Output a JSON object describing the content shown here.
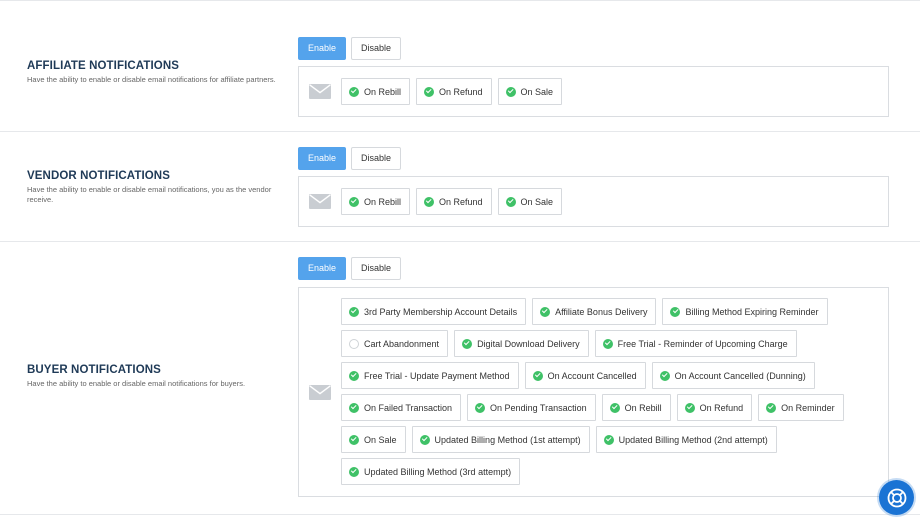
{
  "affiliate": {
    "title": "AFFILIATE NOTIFICATIONS",
    "description": "Have the ability to enable or disable email notifications for affiliate partners.",
    "enable_label": "Enable",
    "disable_label": "Disable",
    "enabled": true,
    "options": [
      {
        "label": "On Rebill",
        "checked": true
      },
      {
        "label": "On Refund",
        "checked": true
      },
      {
        "label": "On Sale",
        "checked": true
      }
    ]
  },
  "vendor": {
    "title": "VENDOR NOTIFICATIONS",
    "description": "Have the ability to enable or disable email notifications, you as the vendor receive.",
    "enable_label": "Enable",
    "disable_label": "Disable",
    "enabled": true,
    "options": [
      {
        "label": "On Rebill",
        "checked": true
      },
      {
        "label": "On Refund",
        "checked": true
      },
      {
        "label": "On Sale",
        "checked": true
      }
    ]
  },
  "buyer": {
    "title": "BUYER NOTIFICATIONS",
    "description": "Have the ability to enable or disable email notifications for buyers.",
    "enable_label": "Enable",
    "disable_label": "Disable",
    "enabled": true,
    "options": [
      {
        "label": "3rd Party Membership Account Details",
        "checked": true
      },
      {
        "label": "Affiliate Bonus Delivery",
        "checked": true
      },
      {
        "label": "Billing Method Expiring Reminder",
        "checked": true
      },
      {
        "label": "Cart Abandonment",
        "checked": false
      },
      {
        "label": "Digital Download Delivery",
        "checked": true
      },
      {
        "label": "Free Trial - Reminder of Upcoming Charge",
        "checked": true
      },
      {
        "label": "Free Trial - Update Payment Method",
        "checked": true
      },
      {
        "label": "On Account Cancelled",
        "checked": true
      },
      {
        "label": "On Account Cancelled (Dunning)",
        "checked": true
      },
      {
        "label": "On Failed Transaction",
        "checked": true
      },
      {
        "label": "On Pending Transaction",
        "checked": true
      },
      {
        "label": "On Rebill",
        "checked": true
      },
      {
        "label": "On Refund",
        "checked": true
      },
      {
        "label": "On Reminder",
        "checked": true
      },
      {
        "label": "On Sale",
        "checked": true
      },
      {
        "label": "Updated Billing Method (1st attempt)",
        "checked": true
      },
      {
        "label": "Updated Billing Method (2nd attempt)",
        "checked": true
      },
      {
        "label": "Updated Billing Method (3rd attempt)",
        "checked": true
      }
    ]
  },
  "colors": {
    "accent": "#54a3ec",
    "check": "#3fc167",
    "title": "#1f3a57",
    "help_button": "#1a73d4"
  },
  "icons": {
    "mail": "envelope-icon",
    "checked": "check-circle-icon",
    "unchecked": "empty-circle-icon",
    "help": "lifebuoy-icon"
  }
}
